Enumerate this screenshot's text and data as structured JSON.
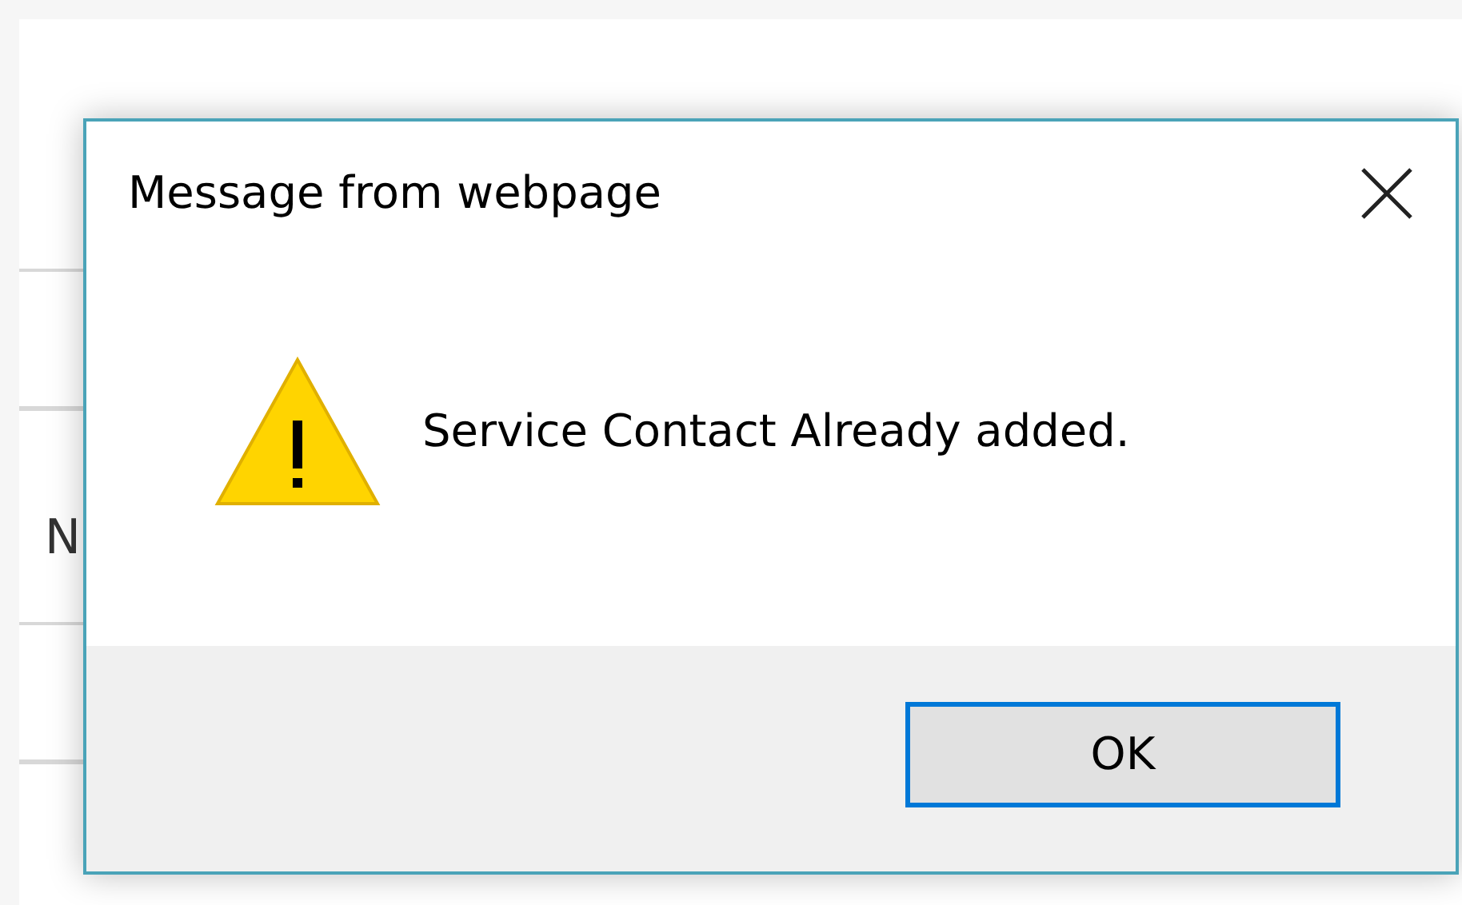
{
  "background": {
    "label": "N"
  },
  "dialog": {
    "title": "Message from webpage",
    "message": "Service Contact Already added.",
    "buttons": [
      {
        "label": "OK",
        "focused": true
      }
    ]
  }
}
